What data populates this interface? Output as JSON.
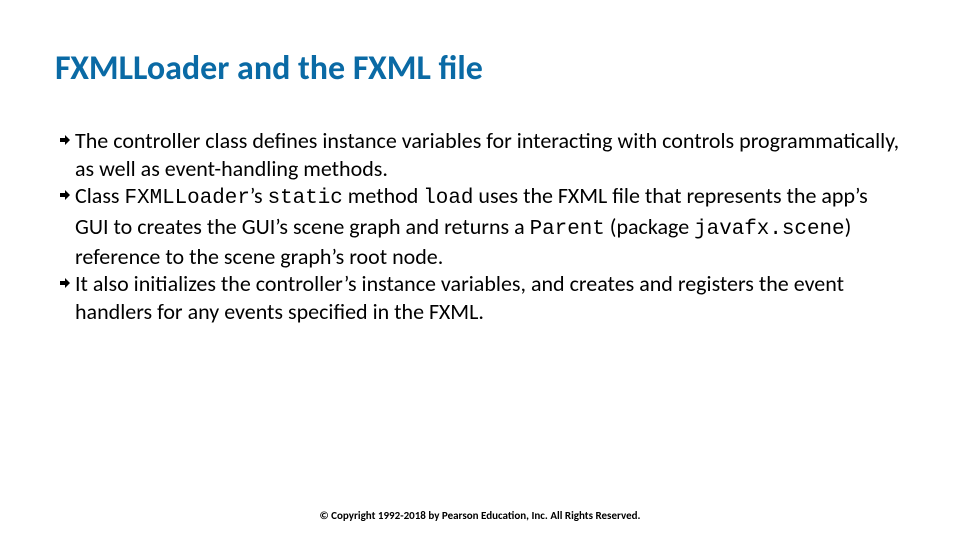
{
  "title": "FXMLLoader and the FXML file",
  "bullets": [
    {
      "segments": [
        {
          "t": "The controller class defines instance variables for interacting with controls programmatically, as well as event-handling methods.",
          "m": false
        }
      ]
    },
    {
      "segments": [
        {
          "t": "Class ",
          "m": false
        },
        {
          "t": "FXMLLoader",
          "m": true
        },
        {
          "t": "’s ",
          "m": false
        },
        {
          "t": "static",
          "m": true
        },
        {
          "t": " method ",
          "m": false
        },
        {
          "t": "load",
          "m": true
        },
        {
          "t": " uses the FXML file that represents the app’s GUI to creates the GUI’s scene graph and returns a ",
          "m": false
        },
        {
          "t": "Parent",
          "m": true
        },
        {
          "t": " (package ",
          "m": false
        },
        {
          "t": "javafx.scene",
          "m": true
        },
        {
          "t": ") reference to the scene graph’s root node.",
          "m": false
        }
      ]
    },
    {
      "segments": [
        {
          "t": "It also initializes the controller’s instance variables, and creates and registers the event handlers for any events specified in the FXML.",
          "m": false
        }
      ]
    }
  ],
  "footer": "© Copyright 1992-2018 by Pearson Education, Inc. All Rights Reserved.",
  "icon_fill": "#000000"
}
